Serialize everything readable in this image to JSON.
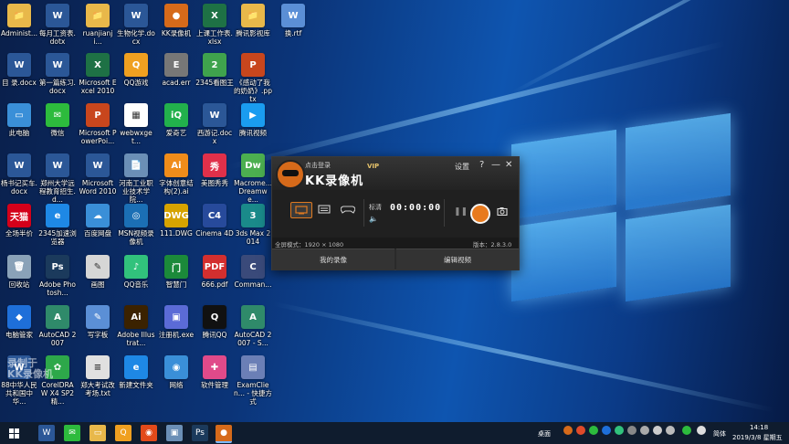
{
  "desktop_icons": [
    {
      "label": "Administ...",
      "glyph": "📁",
      "color": "#e8b84a"
    },
    {
      "label": "每月工资表.dotx",
      "glyph": "W",
      "color": "#2b5797"
    },
    {
      "label": "ruanjianji...",
      "glyph": "📁",
      "color": "#e8b84a"
    },
    {
      "label": "生物化学.docx",
      "glyph": "W",
      "color": "#2b5797"
    },
    {
      "label": "KK录像机",
      "glyph": "●",
      "color": "#d66a1a"
    },
    {
      "label": "上课工作表.xlsx",
      "glyph": "X",
      "color": "#1e7145"
    },
    {
      "label": "腾讯影视库",
      "glyph": "📁",
      "color": "#e8b84a"
    },
    {
      "label": "换.rtf",
      "glyph": "W",
      "color": "#5b8fd6"
    },
    {
      "label": "目 录.docx",
      "glyph": "W",
      "color": "#2b5797"
    },
    {
      "label": "第一篇练习.docx",
      "glyph": "W",
      "color": "#2b5797"
    },
    {
      "label": "Microsoft Excel 2010",
      "glyph": "X",
      "color": "#1e7145"
    },
    {
      "label": "QQ游戏",
      "glyph": "Q",
      "color": "#f0a020"
    },
    {
      "label": "acad.err",
      "glyph": "E",
      "color": "#777777"
    },
    {
      "label": "2345看图王",
      "glyph": "2",
      "color": "#3fa34d"
    },
    {
      "label": "《感动了我的奶奶》.pptx",
      "glyph": "P",
      "color": "#c8461d"
    },
    {
      "label": "",
      "glyph": "",
      "color": "transparent"
    },
    {
      "label": "此电脑",
      "glyph": "▭",
      "color": "#3a8fd8"
    },
    {
      "label": "微信",
      "glyph": "✉",
      "color": "#2dbb3d"
    },
    {
      "label": "Microsoft PowerPoi...",
      "glyph": "P",
      "color": "#c8461d"
    },
    {
      "label": "webwxget...",
      "glyph": "▦",
      "color": "#ffffff"
    },
    {
      "label": "爱奇艺",
      "glyph": "iQ",
      "color": "#22b14c"
    },
    {
      "label": "西游记.docx",
      "glyph": "W",
      "color": "#2b5797"
    },
    {
      "label": "腾讯视频",
      "glyph": "▶",
      "color": "#1a9cf0"
    },
    {
      "label": "",
      "glyph": "",
      "color": "transparent"
    },
    {
      "label": "杨书记买车.docx",
      "glyph": "W",
      "color": "#2b5797"
    },
    {
      "label": "郑州大学远程教育招生.d...",
      "glyph": "W",
      "color": "#2b5797"
    },
    {
      "label": "Microsoft Word 2010",
      "glyph": "W",
      "color": "#2b5797"
    },
    {
      "label": "河南工业职业技术学院...",
      "glyph": "📄",
      "color": "#6b8fb6"
    },
    {
      "label": "字体创意结构(2).ai",
      "glyph": "Ai",
      "color": "#f08c1a"
    },
    {
      "label": "美图秀秀",
      "glyph": "秀",
      "color": "#e0304a"
    },
    {
      "label": "Macrome... Dreamwe...",
      "glyph": "Dw",
      "color": "#4caf50"
    },
    {
      "label": "",
      "glyph": "",
      "color": "transparent"
    },
    {
      "label": "全场半价",
      "glyph": "天猫",
      "color": "#d4001a"
    },
    {
      "label": "2345加速浏览器",
      "glyph": "e",
      "color": "#1e88e5"
    },
    {
      "label": "百度网盘",
      "glyph": "☁",
      "color": "#3a8fd8"
    },
    {
      "label": "MSN视频录像机",
      "glyph": "◎",
      "color": "#1b6fb5"
    },
    {
      "label": "111.DWG",
      "glyph": "DWG",
      "color": "#d6a300"
    },
    {
      "label": "Cinema 4D",
      "glyph": "C4",
      "color": "#274a9b"
    },
    {
      "label": "3ds Max 2014",
      "glyph": "3",
      "color": "#1a8a8a"
    },
    {
      "label": "",
      "glyph": "",
      "color": "transparent"
    },
    {
      "label": "回收站",
      "glyph": "🗑",
      "color": "#8aa2b8"
    },
    {
      "label": "Adobe Photosh...",
      "glyph": "Ps",
      "color": "#1b3a5c"
    },
    {
      "label": "画图",
      "glyph": "✎",
      "color": "#d6d6d6"
    },
    {
      "label": "QQ音乐",
      "glyph": "♪",
      "color": "#31c27c"
    },
    {
      "label": "智慧门",
      "glyph": "门",
      "color": "#1b8a3a"
    },
    {
      "label": "666.pdf",
      "glyph": "PDF",
      "color": "#d32f2f"
    },
    {
      "label": "Comman...",
      "glyph": "C",
      "color": "#3a4a7a"
    },
    {
      "label": "",
      "glyph": "",
      "color": "transparent"
    },
    {
      "label": "电脑管家",
      "glyph": "◆",
      "color": "#1e6fd9"
    },
    {
      "label": "AutoCAD 2007",
      "glyph": "A",
      "color": "#2f8a6a"
    },
    {
      "label": "写字板",
      "glyph": "✎",
      "color": "#5b8fd6"
    },
    {
      "label": "Adobe Illustrat...",
      "glyph": "Ai",
      "color": "#3b2200"
    },
    {
      "label": "注册机.exe",
      "glyph": "▣",
      "color": "#5b6bd6"
    },
    {
      "label": "腾讯QQ",
      "glyph": "Q",
      "color": "#111111"
    },
    {
      "label": "AutoCAD 2007 - S...",
      "glyph": "A",
      "color": "#2f8a6a"
    },
    {
      "label": "",
      "glyph": "",
      "color": "transparent"
    },
    {
      "label": "88中华人民共和国中华...",
      "glyph": "W",
      "color": "#2b5797"
    },
    {
      "label": "CorelDRAW X4 SP2 精...",
      "glyph": "✿",
      "color": "#2da84a"
    },
    {
      "label": "郑大考试改考场.txt",
      "glyph": "≡",
      "color": "#e0e0e0"
    },
    {
      "label": "新建文件夹",
      "glyph": "e",
      "color": "#1e88e5"
    },
    {
      "label": "网络",
      "glyph": "◉",
      "color": "#3a8fd8"
    },
    {
      "label": "软件管理",
      "glyph": "✚",
      "color": "#e04a8a"
    },
    {
      "label": "ExamClien... - 快捷方式",
      "glyph": "▤",
      "color": "#6b7fb6"
    },
    {
      "label": "",
      "glyph": "",
      "color": "transparent"
    }
  ],
  "watermark": {
    "line1": "录制于",
    "line2": "KK录像机"
  },
  "kk": {
    "login": "点击登录",
    "title": "KK录像机",
    "vip": "VIP",
    "settings": "设置",
    "help": "?",
    "minimize": "—",
    "close": "✕",
    "quality": "标清",
    "timer": "00:00:00",
    "resolution": "全屏模式：1920 × 1080",
    "version": "版本：2.8.3.0",
    "tab_records": "我的录像",
    "tab_edit": "编辑视频"
  },
  "taskbar": {
    "desktop_label": "桌面",
    "lang": "简体",
    "time": "14:18",
    "date": "2019/3/8 星期五"
  }
}
